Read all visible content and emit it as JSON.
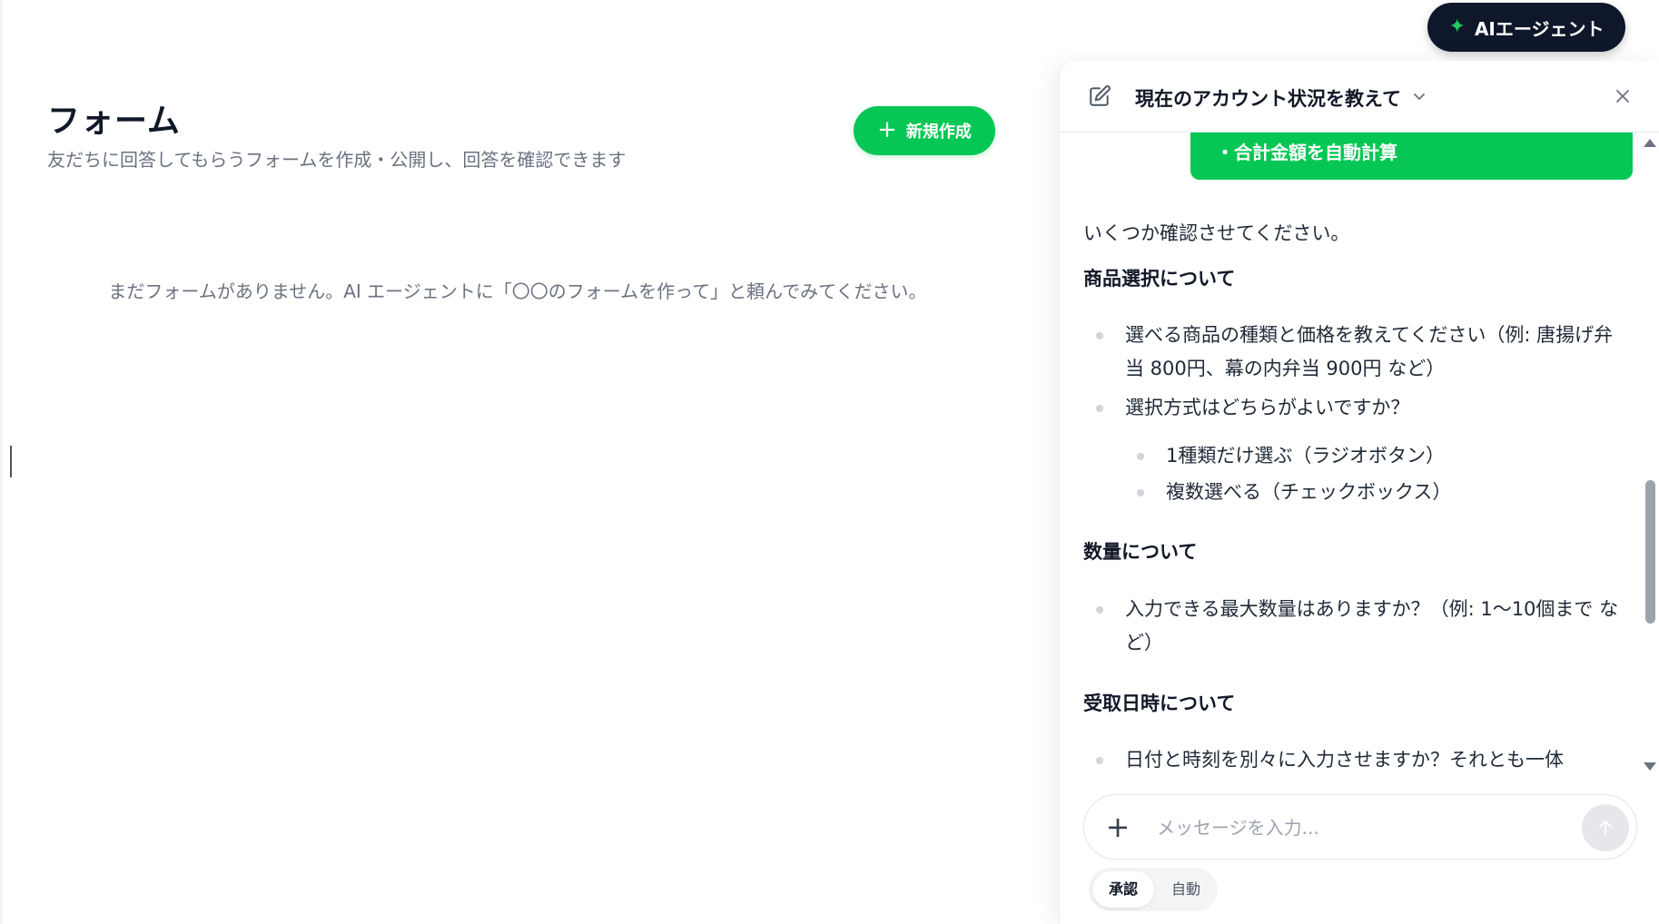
{
  "main": {
    "title": "フォーム",
    "subtitle": "友だちに回答してもらうフォームを作成・公開し、回答を確認できます",
    "new_button_label": "新規作成",
    "empty_message": "まだフォームがありません。AI エージェントに「〇〇のフォームを作って」と頼んでみてください。"
  },
  "ai_button": {
    "label": "AIエージェント",
    "icon": "sparkle-icon"
  },
  "panel": {
    "title": "現在のアカウント状況を教えて",
    "user_bubble_tail": "・合計金額を自動計算",
    "intro": "いくつか確認させてください。",
    "sections": [
      {
        "heading": "商品選択について",
        "bullets": [
          "選べる商品の種類と価格を教えてください（例: 唐揚げ弁当 800円、幕の内弁当 900円 など）",
          "選択方式はどちらがよいですか？"
        ],
        "sub_bullets": [
          "1種類だけ選ぶ（ラジオボタン）",
          "複数選べる（チェックボックス）"
        ]
      },
      {
        "heading": "数量について",
        "bullets": [
          "入力できる最大数量はありますか？（例: 1〜10個まで など）"
        ]
      },
      {
        "heading": "受取日時について",
        "bullets": [
          "日付と時刻を別々に入力させますか？それとも一体"
        ]
      }
    ],
    "input": {
      "placeholder": "メッセージを入力...",
      "value": ""
    },
    "modes": {
      "approve": "承認",
      "auto": "自動",
      "selected": "承認"
    }
  },
  "colors": {
    "accent": "#06c755",
    "dark_button": "#0f172a",
    "sparkle": "#22c55e"
  }
}
